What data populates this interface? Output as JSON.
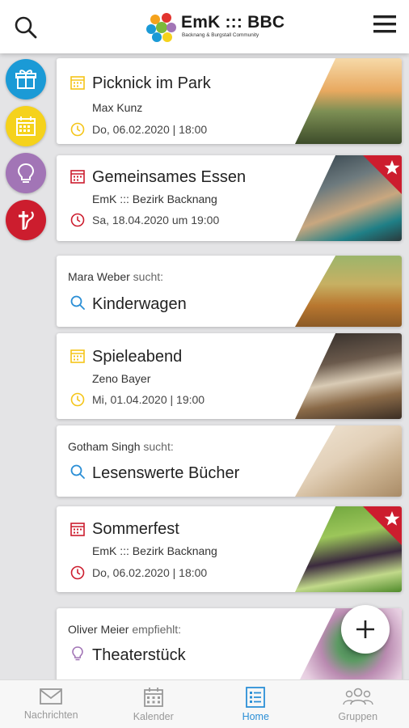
{
  "header": {
    "logo_title": "EmK ::: BBC",
    "logo_subtitle": "Backnang & Burgstall Community"
  },
  "filters": [
    {
      "name": "gifts",
      "icon": "gift-icon",
      "color": "#1b9ad6"
    },
    {
      "name": "calendar",
      "icon": "calendar-icon",
      "color": "#f5d21c"
    },
    {
      "name": "ideas",
      "icon": "lightbulb-icon",
      "color": "#a275b6"
    },
    {
      "name": "church",
      "icon": "methodist-cross-icon",
      "color": "#cc1d2e"
    }
  ],
  "feed": {
    "cards": [
      {
        "type": "event",
        "title": "Picknick im Park",
        "organizer": "Max Kunz",
        "date": "Do, 06.02.2020 | 18:00",
        "accent": "#f5c518",
        "featured": false
      },
      {
        "type": "event",
        "title": "Gemeinsames Essen",
        "organizer": "EmK ::: Bezirk Backnang",
        "date": "Sa, 18.04.2020 um 19:00",
        "accent": "#cc1d2e",
        "featured": true
      },
      {
        "type": "search",
        "person": "Mara Weber",
        "verb": "sucht:",
        "title": "Kinderwagen",
        "accent": "#2b8fd6"
      },
      {
        "type": "event",
        "title": "Spieleabend",
        "organizer": "Zeno Bayer",
        "date": "Mi, 01.04.2020 | 19:00",
        "accent": "#f5c518",
        "featured": false
      },
      {
        "type": "search",
        "person": "Gotham Singh",
        "verb": "sucht:",
        "title": "Lesenswerte Bücher",
        "accent": "#2b8fd6"
      },
      {
        "type": "event",
        "title": "Sommerfest",
        "organizer": "EmK ::: Bezirk Backnang",
        "date": "Do, 06.02.2020 | 18:00",
        "accent": "#cc1d2e",
        "featured": true
      },
      {
        "type": "recommend",
        "person": "Oliver Meier",
        "verb": "empfiehlt:",
        "title": "Theaterstück",
        "accent": "#a275b6"
      }
    ]
  },
  "bottom_nav": {
    "tabs": [
      {
        "label": "Nachrichten",
        "icon": "envelope-icon",
        "active": false
      },
      {
        "label": "Kalender",
        "icon": "calendar-icon",
        "active": false
      },
      {
        "label": "Home",
        "icon": "list-icon",
        "active": true
      },
      {
        "label": "Gruppen",
        "icon": "group-icon",
        "active": false
      }
    ]
  },
  "colors": {
    "active": "#2b8fd6",
    "inactive": "#999999"
  }
}
